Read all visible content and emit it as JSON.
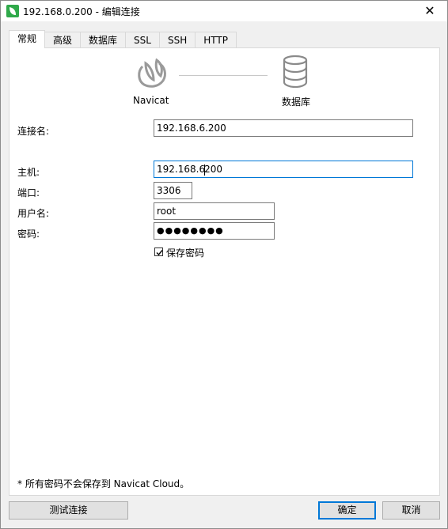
{
  "window": {
    "title": "192.168.0.200 - 编辑连接",
    "close_glyph": "✕"
  },
  "tabs": [
    {
      "label": "常规",
      "active": true
    },
    {
      "label": "高级",
      "active": false
    },
    {
      "label": "数据库",
      "active": false
    },
    {
      "label": "SSL",
      "active": false
    },
    {
      "label": "SSH",
      "active": false
    },
    {
      "label": "HTTP",
      "active": false
    }
  ],
  "diagram": {
    "left_label": "Navicat",
    "left_icon": "navicat-logo-icon",
    "right_label": "数据库",
    "right_icon": "database-icon"
  },
  "form": {
    "connection_name_label": "连接名:",
    "connection_name_value": "192.168.6.200",
    "host_label": "主机:",
    "host_value_before_caret": "192.168.6",
    "host_value_after_caret": "200",
    "port_label": "端口:",
    "port_value": "3306",
    "username_label": "用户名:",
    "username_value": "root",
    "password_label": "密码:",
    "password_value": "●●●●●●●●",
    "save_password_label": "保存密码",
    "save_password_checked": true
  },
  "footnote": "* 所有密码不会保存到 Navicat Cloud。",
  "buttons": {
    "test": "测试连接",
    "ok": "确定",
    "cancel": "取消"
  },
  "colors": {
    "accent": "#0078d7",
    "app_icon": "#2fa94a"
  }
}
